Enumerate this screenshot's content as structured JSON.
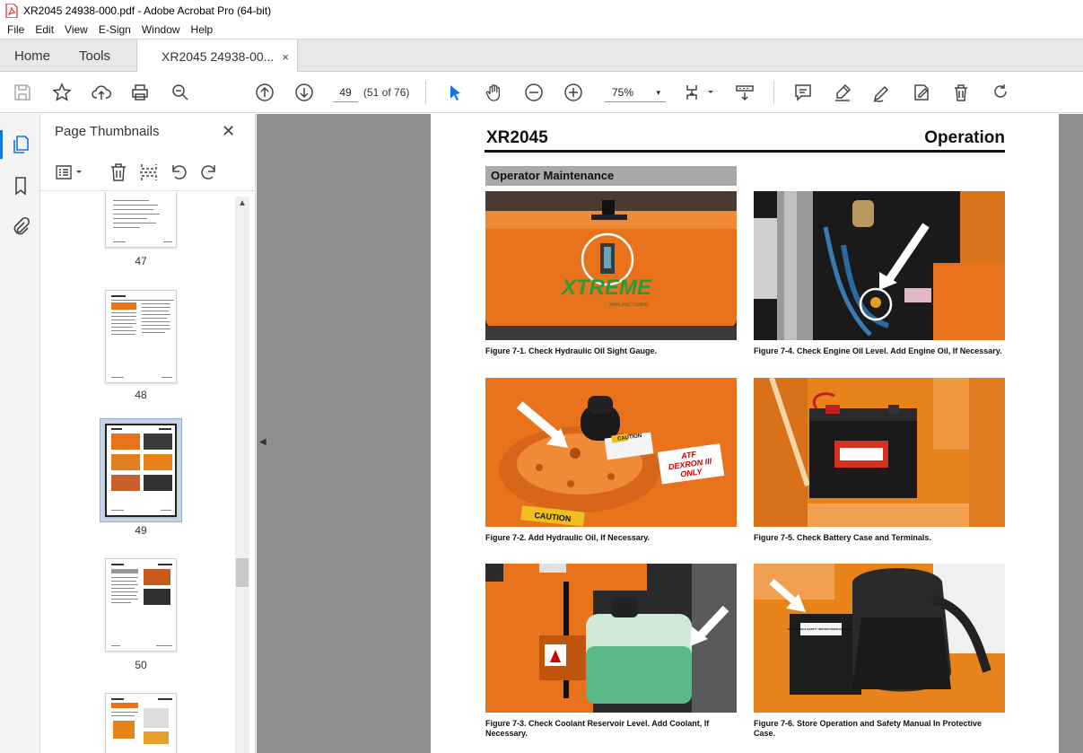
{
  "window": {
    "title": "XR2045 24938-000.pdf - Adobe Acrobat Pro (64-bit)"
  },
  "menu": [
    "File",
    "Edit",
    "View",
    "E-Sign",
    "Window",
    "Help"
  ],
  "tabs": {
    "home": "Home",
    "tools": "Tools",
    "document": "XR2045 24938-00...",
    "close": "×"
  },
  "toolbar": {
    "page_input": "49",
    "page_count": "(51 of 76)",
    "zoom": "75%",
    "zoom_caret": "▾"
  },
  "thumbnails": {
    "title": "Page Thumbnails",
    "close": "✕",
    "scroll_up": "▲",
    "collapse": "◀",
    "pages": [
      {
        "label": "47"
      },
      {
        "label": "48"
      },
      {
        "label": "49",
        "selected": true
      },
      {
        "label": "50"
      }
    ]
  },
  "document": {
    "model": "XR2045",
    "section": "Operation",
    "subsection": "Operator Maintenance",
    "figures": [
      {
        "id": "fig-7-1",
        "caption": "Figure 7-1.  Check Hydraulic Oil Sight Gauge."
      },
      {
        "id": "fig-7-4",
        "caption": "Figure 7-4.  Check Engine Oil Level.  Add Engine Oil, If Necessary."
      },
      {
        "id": "fig-7-2",
        "caption": "Figure 7-2.  Add Hydraulic Oil, If Necessary."
      },
      {
        "id": "fig-7-5",
        "caption": "Figure 7-5.  Check Battery Case and Terminals."
      },
      {
        "id": "fig-7-3",
        "caption": "Figure 7-3.  Check Coolant Reservoir Level.  Add Coolant, If Necessary."
      },
      {
        "id": "fig-7-6",
        "caption": "Figure 7-6.  Store Operation and Safety Manual In Protective Case."
      }
    ],
    "photo_text": {
      "brand": "XTREME",
      "brand_sub": "MANUFACTURING",
      "caution": "CAUTION",
      "atf_label": "ATF DEXRON III ONLY",
      "atf_line1": "ATF",
      "atf_line2": "DEXRON III",
      "atf_line3": "ONLY",
      "manual_case": "OPERATION & SAFETY INSTRUCTIONS ENCLOSED"
    }
  },
  "colors": {
    "accent": "#1473e6",
    "machine_orange": "#e8731c",
    "section_bar": "#a9a9a9",
    "doc_bg": "#8f8f8f"
  }
}
